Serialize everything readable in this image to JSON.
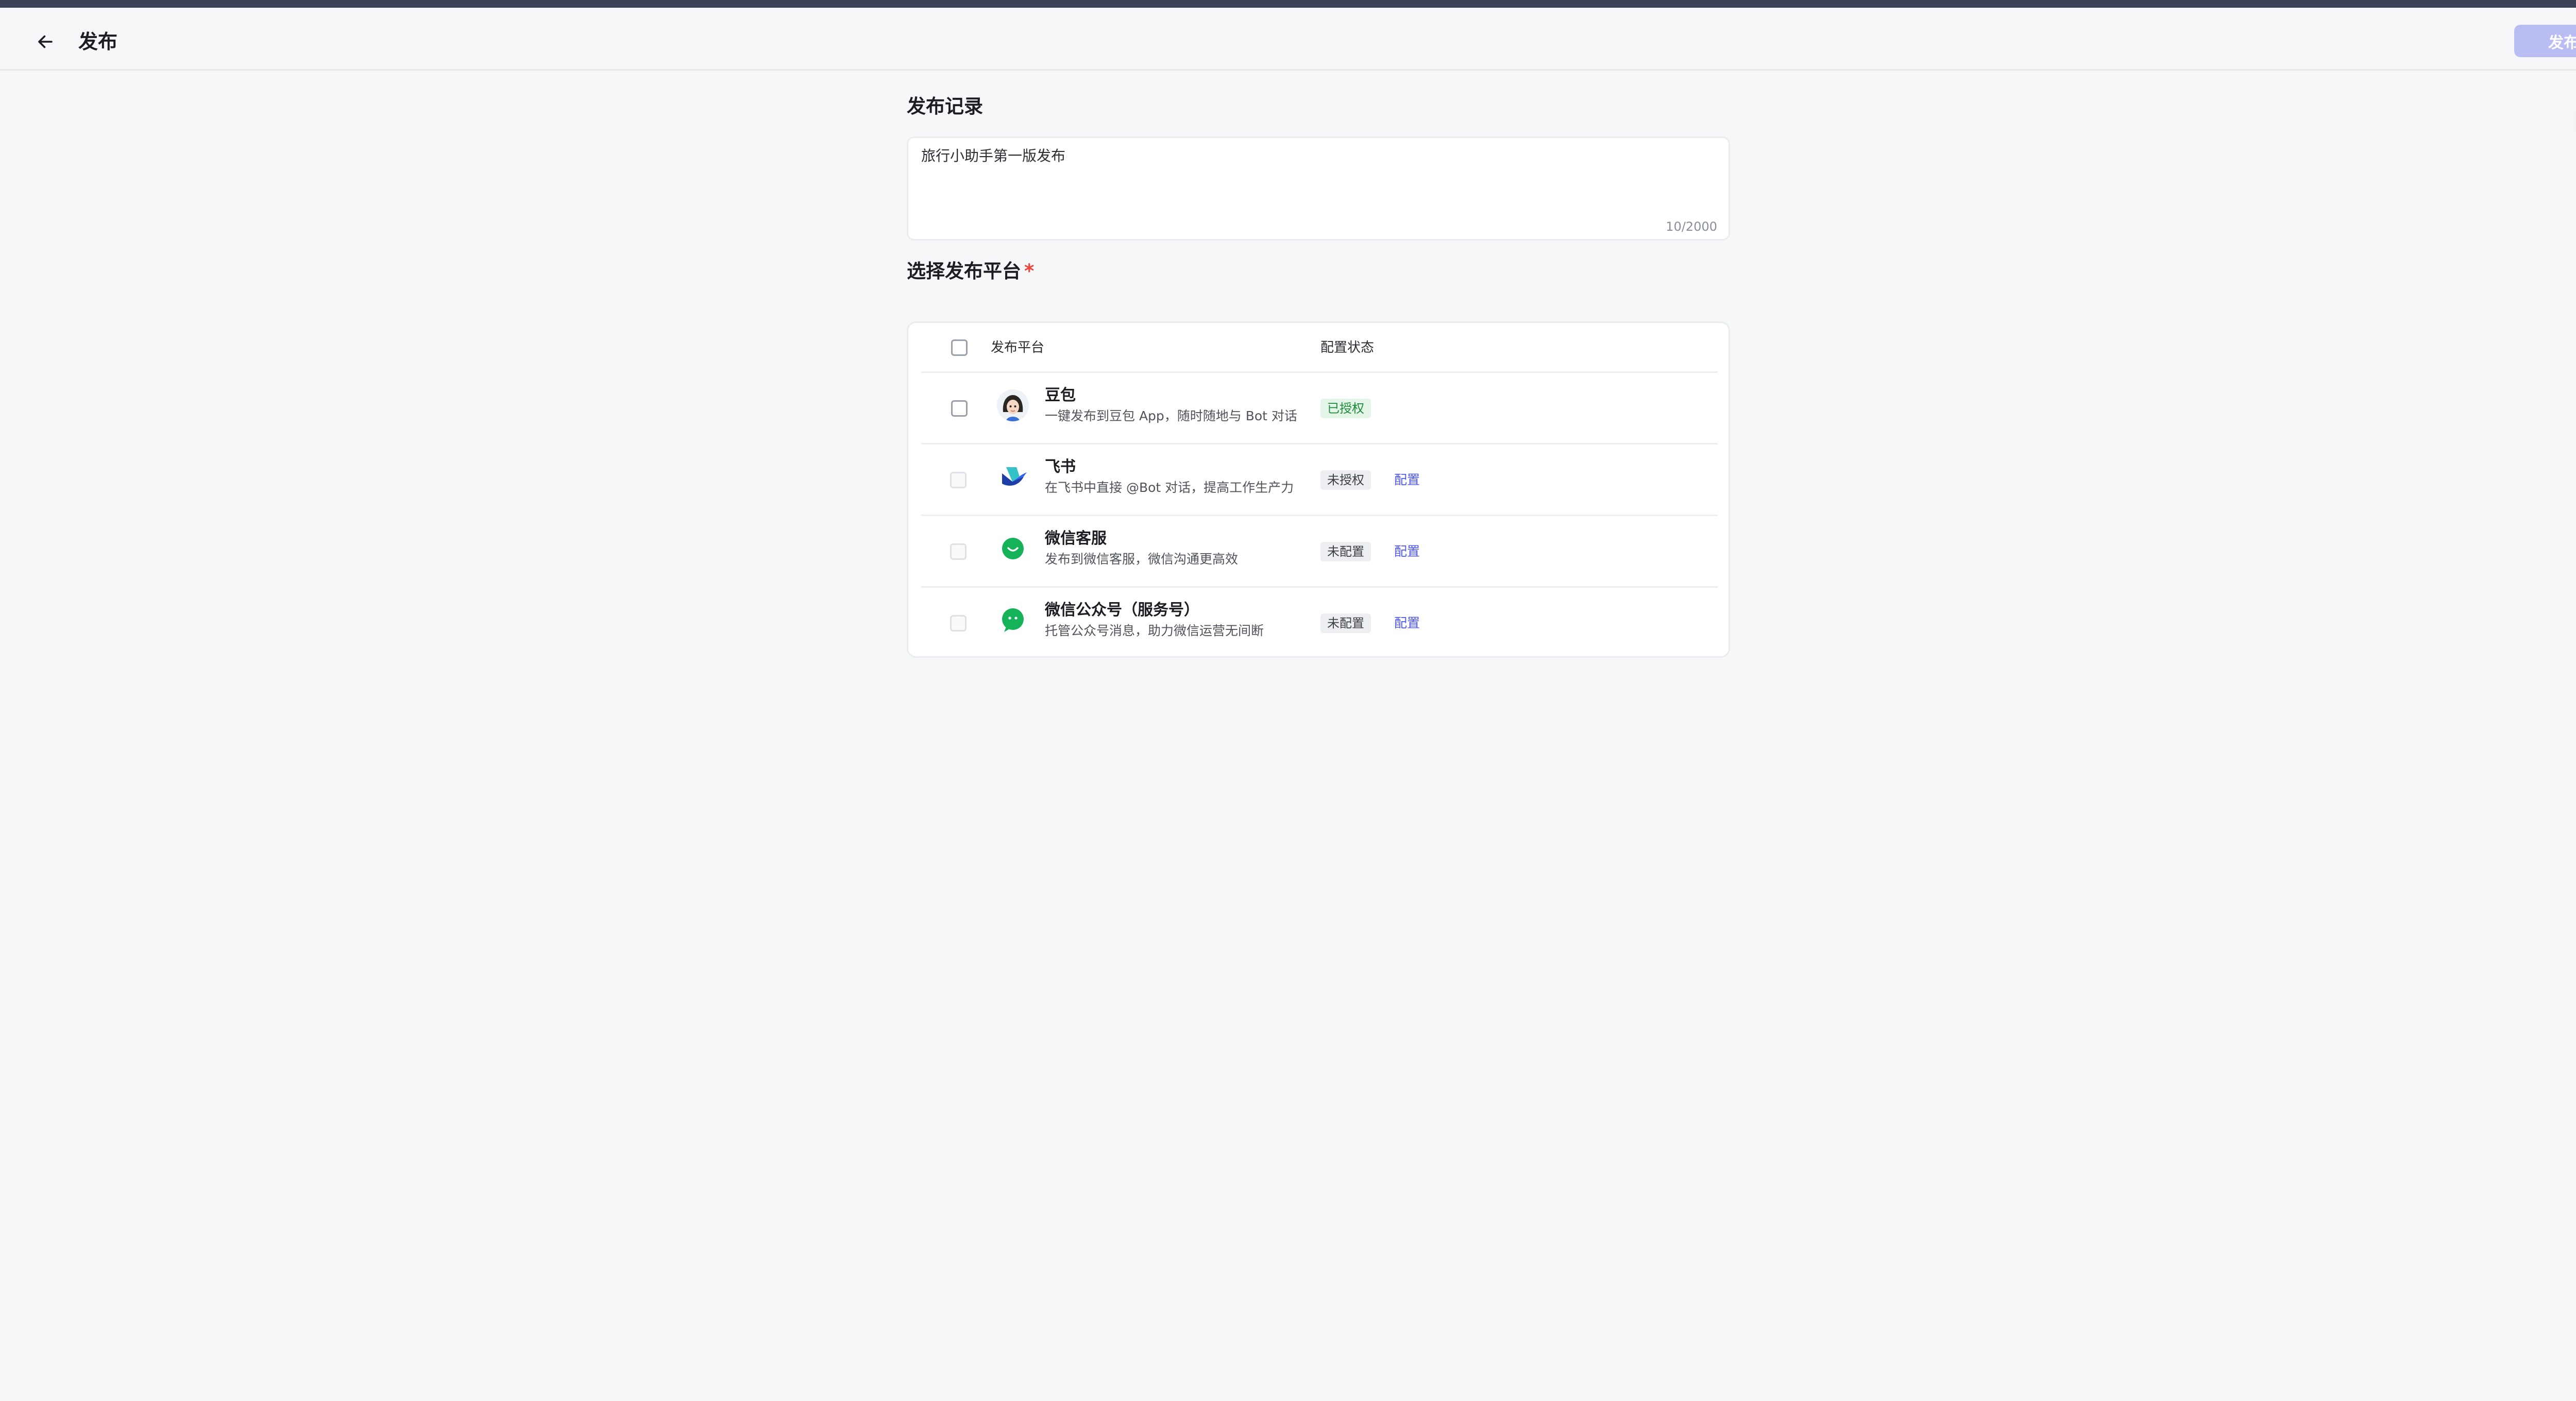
{
  "header": {
    "title": "发布",
    "publish_label": "发布"
  },
  "record": {
    "title": "发布记录",
    "value": "旅行小助手第一版发布",
    "counter": "10/2000"
  },
  "platforms_section": {
    "title": "选择发布平台",
    "required_mark": "*",
    "col_platform": "发布平台",
    "col_status": "配置状态"
  },
  "platforms": [
    {
      "name": "豆包",
      "desc": "一键发布到豆包 App，随时随地与 Bot 对话",
      "status": "已授权",
      "status_kind": "ok",
      "config": "",
      "icon": "doubao-icon"
    },
    {
      "name": "飞书",
      "desc": "在飞书中直接 @Bot 对话，提高工作生产力",
      "status": "未授权",
      "status_kind": "no",
      "config": "配置",
      "icon": "feishu-icon"
    },
    {
      "name": "微信客服",
      "desc": "发布到微信客服，微信沟通更高效",
      "status": "未配置",
      "status_kind": "no",
      "config": "配置",
      "icon": "wechat-service-icon"
    },
    {
      "name": "微信公众号（服务号）",
      "desc": "托管公众号消息，助力微信运营无间断",
      "status": "未配置",
      "status_kind": "no",
      "config": "配置",
      "icon": "wechat-official-account-icon"
    }
  ],
  "colors": {
    "accent": "#4e57ef",
    "publish_disabled": "#b9bdf4",
    "authorized_bg": "#e2f5e6",
    "authorized_text": "#1f8a3a",
    "required": "#f04438"
  }
}
